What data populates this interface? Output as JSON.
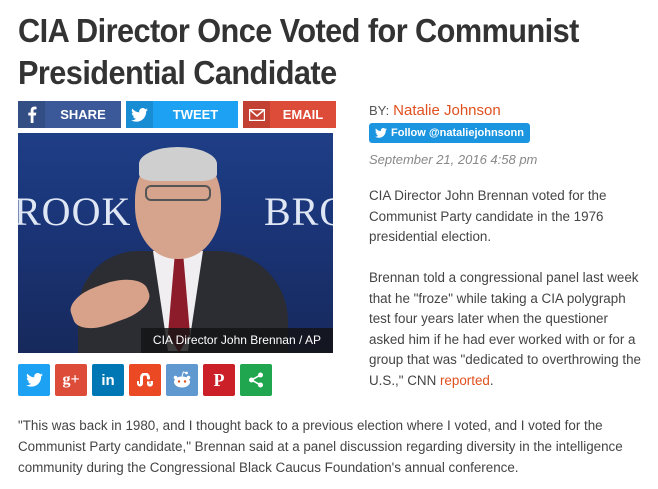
{
  "article": {
    "headline": "CIA Director Once Voted for Communist Presidential Candidate",
    "byline_prefix": "BY:",
    "author": "Natalie Johnson",
    "follow_label": "Follow @nataliejohnsonn",
    "date": "September 21, 2016 4:58 pm",
    "photo_caption": "CIA Director John Brennan / AP",
    "photo_backdrop_text_left": "ROOK",
    "photo_backdrop_text_right": "BRO",
    "paragraph1": "CIA Director John Brennan voted for the Communist Party candidate in the 1976 presidential election.",
    "paragraph2_before_link": "Brennan told a congressional panel last week that he \"froze\" while taking a CIA polygraph test four years later when the questioner asked him if he had ever worked with or for a group that was \"dedicated to overthrowing the U.S.,\" CNN ",
    "paragraph2_link": "reported",
    "paragraph2_after_link": ".",
    "paragraph3": "\"This was back in 1980, and I thought back to a previous election where I voted, and I voted for the Communist Party candidate,\" Brennan said at a panel discussion regarding diversity in the intelligence community during the Congressional Black Caucus Foundation's annual conference."
  },
  "share_buttons": [
    {
      "label": "SHARE",
      "icon": "facebook-icon",
      "color": "#3b5998"
    },
    {
      "label": "TWEET",
      "icon": "twitter-icon",
      "color": "#1da1f2"
    },
    {
      "label": "EMAIL",
      "icon": "email-icon",
      "color": "#dd4b39"
    }
  ],
  "social_icons": [
    {
      "name": "twitter-icon",
      "glyph": "🐦",
      "color": "#1da1f2"
    },
    {
      "name": "google-plus-icon",
      "glyph": "g+",
      "color": "#dd4b39"
    },
    {
      "name": "linkedin-icon",
      "glyph": "in",
      "color": "#0077b5"
    },
    {
      "name": "stumbleupon-icon",
      "glyph": "su",
      "color": "#eb4924"
    },
    {
      "name": "reddit-icon",
      "glyph": "👽",
      "color": "#5f99cf"
    },
    {
      "name": "pinterest-icon",
      "glyph": "P",
      "color": "#cb2027"
    },
    {
      "name": "share-icon",
      "glyph": "<",
      "color": "#1fa64f"
    }
  ],
  "colors": {
    "accent": "#e0501f",
    "text": "#444444"
  }
}
